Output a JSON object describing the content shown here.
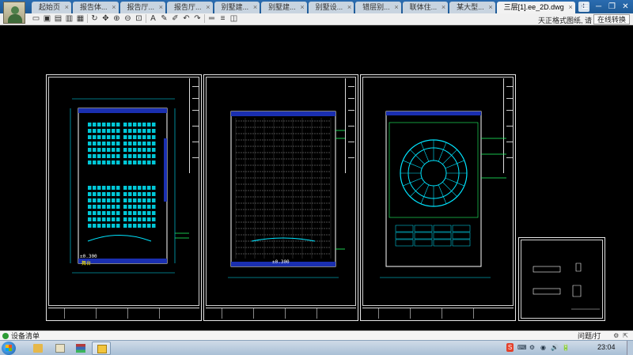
{
  "window": {
    "tabs": [
      {
        "label": "起始页",
        "active": false
      },
      {
        "label": "报告体...",
        "active": false
      },
      {
        "label": "报告厅...",
        "active": false
      },
      {
        "label": "报告厅...",
        "active": false
      },
      {
        "label": "别墅建...",
        "active": false
      },
      {
        "label": "别墅建...",
        "active": false
      },
      {
        "label": "别墅设...",
        "active": false
      },
      {
        "label": "错层别...",
        "active": false
      },
      {
        "label": "联体住...",
        "active": false
      },
      {
        "label": "某大型...",
        "active": false
      },
      {
        "label": "三层[1].ee_2D.dwg",
        "active": true
      }
    ],
    "new_tab": "+",
    "tab_close": "×",
    "controls": [
      "☰",
      "─",
      "❐",
      "✕"
    ]
  },
  "toolbar": {
    "icons": [
      "open-icon",
      "save-icon",
      "print-icon",
      "print-preview-icon",
      "lock-icon",
      "rotate-icon",
      "pan-icon",
      "zoom-in-icon",
      "zoom-out-icon",
      "zoom-extents-icon",
      "text-icon",
      "pen-icon",
      "brush-icon",
      "undo-icon",
      "redo-icon",
      "measure-icon",
      "layer-icon",
      "layers-panel-icon"
    ],
    "notice": "天正格式图纸, 请",
    "switch_label": "在线转换"
  },
  "drawing": {
    "sheet1_labels": {
      "elev": "±0.300",
      "stage": "舞台"
    },
    "sheet2_labels": {
      "elev": "±0.300"
    }
  },
  "statusbar": {
    "label": "设备清单",
    "feedback": "问题/打"
  },
  "taskbar": {
    "tray": [
      "S",
      "⌨",
      "⚙",
      "◉",
      "🔊",
      "🔋"
    ],
    "time": "23:04"
  }
}
